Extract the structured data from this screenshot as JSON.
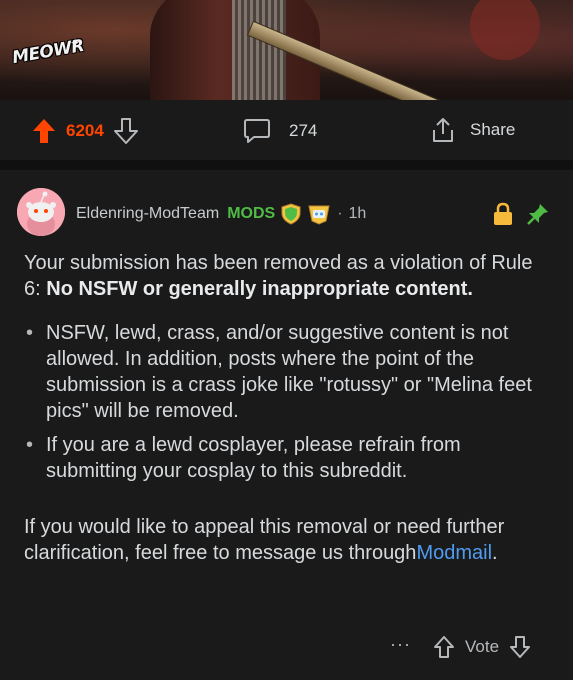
{
  "media": {
    "logo_text": "MEOWR"
  },
  "post_actions": {
    "upvotes": "6204",
    "comments": "274",
    "share_label": "Share"
  },
  "comment": {
    "author": "Eldenring-ModTeam",
    "flair": "MODS",
    "separator": "·",
    "age": "1h",
    "intro": "Your submission has been removed as a violation of Rule 6: ",
    "rule_title": "No NSFW or generally inappropriate content.",
    "rules": [
      "NSFW, lewd, crass, and/or suggestive content is not allowed. In addition, posts where the point of the submission is a crass joke like \"rotussy\" or \"Melina feet pics\" will be removed.",
      "If you are a lewd cosplayer, please refrain from submitting your cosplay to this subreddit."
    ],
    "appeal_text": "If you would like to appeal this removal or need further clarification, feel free to message us through",
    "appeal_link": "Modmail",
    "appeal_end": ".",
    "more_label": "···",
    "vote_label": "Vote"
  },
  "colors": {
    "background": "#121212",
    "card": "#1a1a1b",
    "upvote": "#ff4500",
    "mods": "#4fbc46",
    "link": "#4f9bf0",
    "lock": "#f6b93b",
    "pin": "#4fbc46"
  },
  "icons": [
    "upvote-arrow-icon",
    "downvote-arrow-icon",
    "comment-bubble-icon",
    "share-icon",
    "snoo-avatar-icon",
    "shield-badge-icon",
    "robot-badge-icon",
    "lock-icon",
    "pin-icon",
    "more-icon"
  ]
}
